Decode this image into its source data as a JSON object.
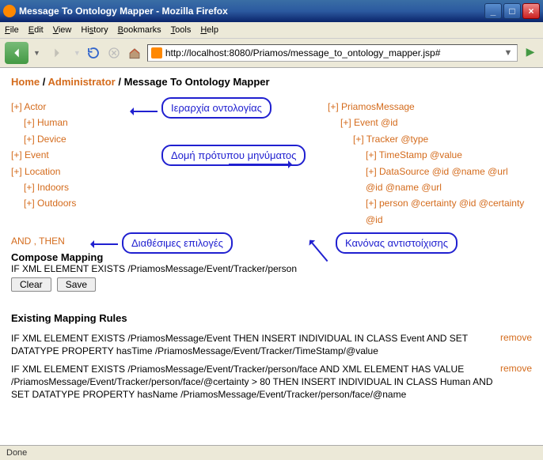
{
  "window": {
    "title": "Message To Ontology Mapper - Mozilla Firefox"
  },
  "menubar": {
    "file": "File",
    "edit": "Edit",
    "view": "View",
    "history": "History",
    "bookmarks": "Bookmarks",
    "tools": "Tools",
    "help": "Help"
  },
  "url": "http://localhost:8080/Priamos/message_to_ontology_mapper.jsp#",
  "breadcrumb": {
    "home": "Home",
    "admin": "Administrator",
    "page": "Message To Ontology Mapper",
    "sep": "/"
  },
  "ontology_tree": [
    {
      "lvl": 0,
      "label": "[+] Actor"
    },
    {
      "lvl": 1,
      "label": "[+] Human"
    },
    {
      "lvl": 1,
      "label": "[+] Device"
    },
    {
      "lvl": 0,
      "label": "[+] Event"
    },
    {
      "lvl": 0,
      "label": "[+] Location"
    },
    {
      "lvl": 1,
      "label": "[+] Indoors"
    },
    {
      "lvl": 1,
      "label": "[+] Outdoors"
    }
  ],
  "message_tree": [
    {
      "lvl": 0,
      "label": "[+] PriamosMessage"
    },
    {
      "lvl": 1,
      "label": "[+] Event  @id"
    },
    {
      "lvl": 2,
      "label": "[+] Tracker  @type"
    },
    {
      "lvl": 3,
      "label": "[+] TimeStamp  @value"
    },
    {
      "lvl": 3,
      "label": "[+] DataSource  @id  @name  @url  @id  @name  @url"
    },
    {
      "lvl": 3,
      "label": "[+] person  @certainty  @id  @certainty  @id"
    }
  ],
  "callouts": {
    "c1": "Ιεραρχία οντολογίας",
    "c2": "Δομή πρότυπου μηνύματος",
    "c3": "Διαθέσιμες επιλογές",
    "c4": "Κανόνας αντιστοίχισης"
  },
  "avail_options": "AND , THEN",
  "compose": {
    "title": "Compose Mapping",
    "text": "IF XML ELEMENT EXISTS /PriamosMessage/Event/Tracker/person",
    "clear": "Clear",
    "save": "Save"
  },
  "rules": {
    "title": "Existing Mapping Rules",
    "items": [
      "IF XML ELEMENT EXISTS /PriamosMessage/Event THEN INSERT INDIVIDUAL IN CLASS Event AND SET DATATYPE PROPERTY hasTime /PriamosMessage/Event/Tracker/TimeStamp/@value",
      "IF XML ELEMENT EXISTS /PriamosMessage/Event/Tracker/person/face AND XML ELEMENT HAS VALUE /PriamosMessage/Event/Tracker/person/face/@certainty > 80 THEN INSERT INDIVIDUAL IN CLASS Human AND SET DATATYPE PROPERTY hasName /PriamosMessage/Event/Tracker/person/face/@name"
    ],
    "remove": "remove"
  },
  "status": "Done"
}
